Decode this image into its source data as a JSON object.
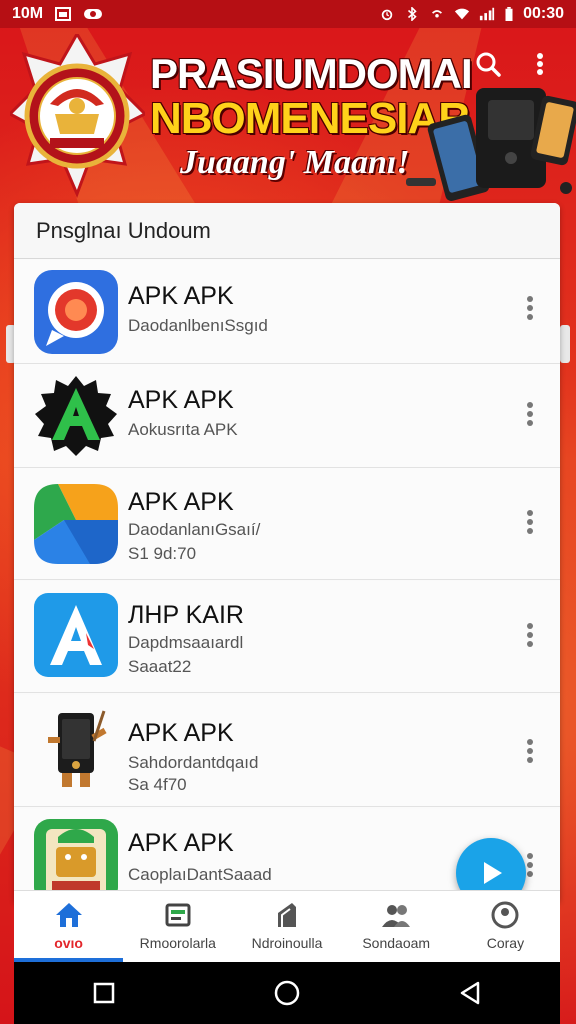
{
  "status_bar": {
    "left_text": "10M",
    "time": "00:30"
  },
  "header": {
    "title_line1": "PRASIUMDOMAI",
    "title_line2": "NBOMENESIAR",
    "subtitle": "Juaang' Maanı!",
    "search_icon": "search-icon",
    "more_icon": "more-vertical-icon"
  },
  "list": {
    "header": "Pnsglnaı Undoum",
    "apps": [
      {
        "name": "APK APK",
        "desc": "DaodanlbenıSsgıd",
        "size": ""
      },
      {
        "name": "APK APK",
        "desc": "Aokusrıta APK",
        "size": ""
      },
      {
        "name": "APK APK",
        "desc": "DaodanlanıGsaıí/",
        "size": "S1 9d:70"
      },
      {
        "name": "ЛHP KAIR",
        "desc": "Dapdmsaaıardl",
        "size": "Saaat22"
      },
      {
        "name": "APK APK",
        "desc": "Sahdordantdqaıd",
        "size": "Sa 4f70"
      },
      {
        "name": "APK APK",
        "desc": "CaoplaıDantSaaad",
        "size": ""
      }
    ]
  },
  "bottom_nav": [
    {
      "label": "ovıo",
      "icon": "home-icon",
      "active": true
    },
    {
      "label": "Rmoorolarla",
      "icon": "category-icon",
      "active": false
    },
    {
      "label": "Ndroinoulla",
      "icon": "android-icon",
      "active": false
    },
    {
      "label": "Sondaoam",
      "icon": "users-icon",
      "active": false
    },
    {
      "label": "Coray",
      "icon": "profile-icon",
      "active": false
    }
  ],
  "colors": {
    "brand_red": "#d9151a",
    "accent_yellow": "#ffd21a",
    "fab_blue": "#1aa3e8",
    "active_nav": "#e3262b"
  }
}
